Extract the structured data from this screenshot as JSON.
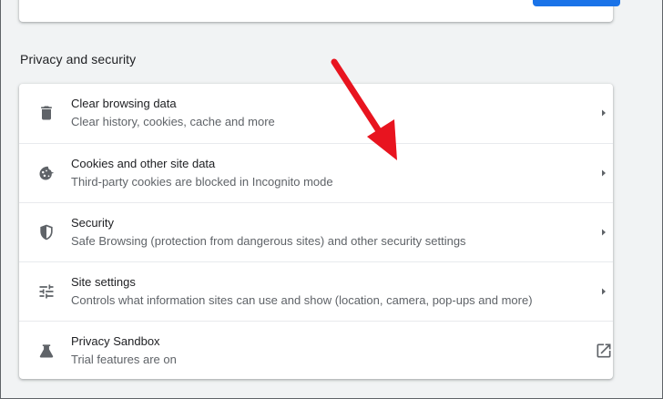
{
  "section": {
    "title": "Privacy and security"
  },
  "items": [
    {
      "label": "Clear browsing data",
      "sub": "Clear history, cookies, cache and more",
      "icon": "trash-icon",
      "action": "chevron-right-icon"
    },
    {
      "label": "Cookies and other site data",
      "sub": "Third-party cookies are blocked in Incognito mode",
      "icon": "cookie-icon",
      "action": "chevron-right-icon"
    },
    {
      "label": "Security",
      "sub": "Safe Browsing (protection from dangerous sites) and other security settings",
      "icon": "shield-icon",
      "action": "chevron-right-icon"
    },
    {
      "label": "Site settings",
      "sub": "Controls what information sites can use and show (location, camera, pop-ups and more)",
      "icon": "tune-icon",
      "action": "chevron-right-icon"
    },
    {
      "label": "Privacy Sandbox",
      "sub": "Trial features are on",
      "icon": "flask-icon",
      "action": "open-in-new-icon"
    }
  ],
  "colors": {
    "accent": "#1a73e8",
    "icon": "#5f6368",
    "annotation": "#e8141f",
    "page_bg": "#f1f3f4"
  }
}
